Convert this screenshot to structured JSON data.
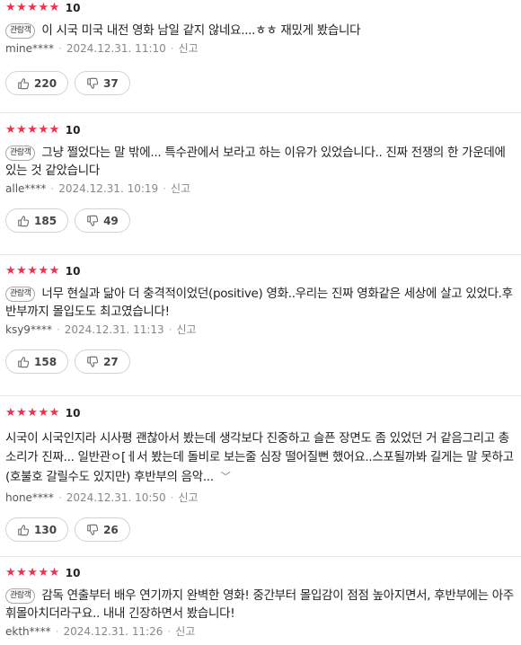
{
  "colors": {
    "star": "#f1304b",
    "border": "#d3d3d3",
    "meta": "#888888"
  },
  "reviews": [
    {
      "stars": "★★★★★",
      "score": "10",
      "badge": "관람객",
      "text": "이 시국 미국 내전 영화 남일 같지 않네요....ㅎㅎ 재밌게 봤습니다",
      "author": "mine****",
      "date": "2024.12.31. 11:10",
      "report": "신고",
      "likes": "220",
      "dislikes": "37"
    },
    {
      "stars": "★★★★★",
      "score": "10",
      "badge": "관람객",
      "text": "그냥 쩔었다는 말 밖에... 특수관에서 보라고 하는 이유가 있었습니다.. 진짜 전쟁의 한 가운데에 있는 것 같았습니다",
      "author": "alle****",
      "date": "2024.12.31. 10:19",
      "report": "신고",
      "likes": "185",
      "dislikes": "49"
    },
    {
      "stars": "★★★★★",
      "score": "10",
      "badge": "관람객",
      "text": "너무 현실과 닮아 더 충격적이었던(positive) 영화..우리는 진짜 영화같은 세상에 살고 있었다.후반부까지 몰입도도 최고였습니다!",
      "author": "ksy9****",
      "date": "2024.12.31. 11:13",
      "report": "신고",
      "likes": "158",
      "dislikes": "27"
    },
    {
      "stars": "★★★★★",
      "score": "10",
      "badge": "",
      "text": "시국이 시국인지라 시사평 괜찮아서 봤는데 생각보다 진중하고 슬픈 장면도 좀 있었던 거 같음그리고 총소리가 진짜... 일반관ㅇ[ㅔ서 봤는데 돌비로 보는줄 심장 떨어질뻔 했어요..스포될까봐 길게는 말 못하고 (호불호 갈릴수도 있지만) 후반부의 음악...",
      "more": "﹀",
      "author": "hone****",
      "date": "2024.12.31. 10:50",
      "report": "신고",
      "likes": "130",
      "dislikes": "26"
    },
    {
      "stars": "★★★★★",
      "score": "10",
      "badge": "관람객",
      "text": "감독 연출부터 배우 연기까지 완벽한 영화! 중간부터 몰입감이 점점 높아지면서, 후반부에는 아주 휘몰아치더라구요.. 내내 긴장하면서 봤습니다!",
      "author": "ekth****",
      "date": "2024.12.31. 11:26",
      "report": "신고"
    }
  ]
}
